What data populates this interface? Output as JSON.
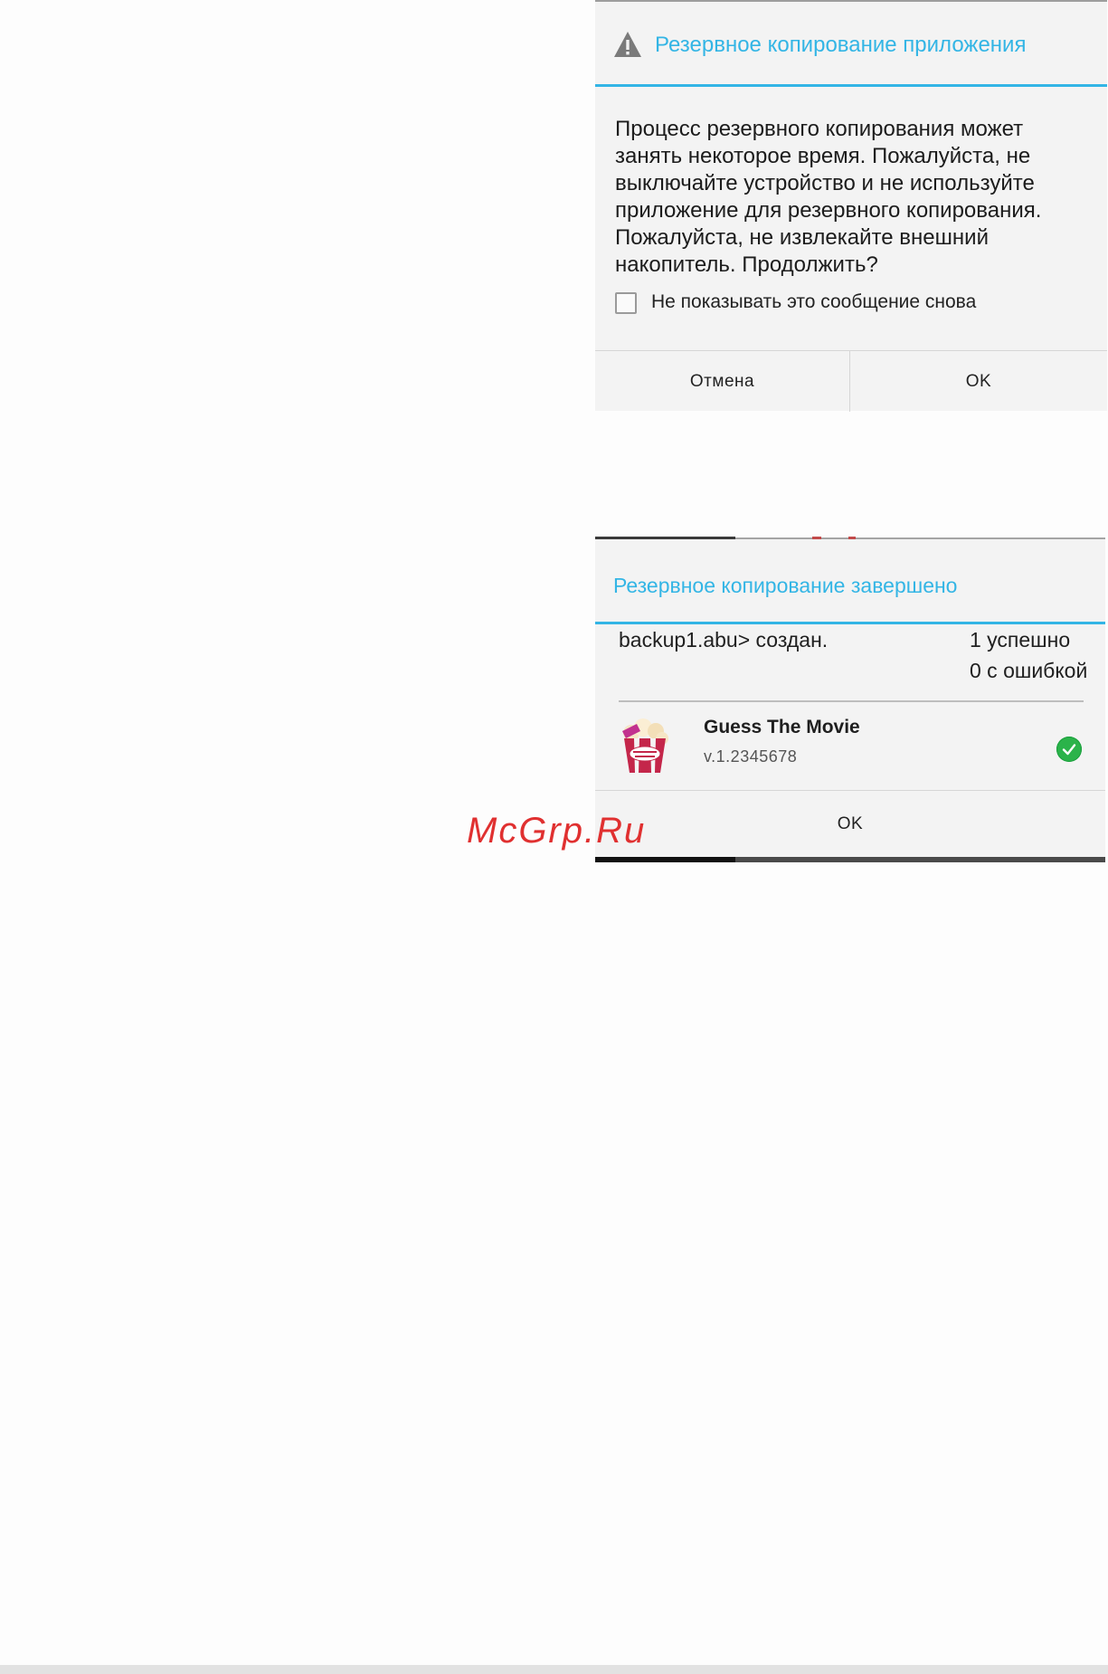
{
  "backup_confirm_dialog": {
    "title": "Резервное копирование приложения",
    "message": "Процесс резервного копирования может занять некоторое время. Пожалуйста, не выключайте устройство и не используйте приложение для резервного копирования. Пожалуйста, не извлекайте внешний накопитель. Продолжить?",
    "dont_show_label": "Не показывать это сообщение снова",
    "dont_show_checked": false,
    "cancel_label": "Отмена",
    "ok_label": "OK",
    "title_icon": "warning-icon",
    "accent_color": "#33b5e5"
  },
  "backup_done_dialog": {
    "title": "Резервное копирование завершено",
    "file_status": "backup1.abu> создан.",
    "success_count": "1 успешно",
    "error_count": "0 с ошибкой",
    "app": {
      "name": "Guess The Movie",
      "version": "v.1.2345678",
      "icon": "popcorn-app-icon",
      "status_icon": "success-check-icon"
    },
    "ok_label": "OK"
  },
  "watermark": "McGrp.Ru"
}
